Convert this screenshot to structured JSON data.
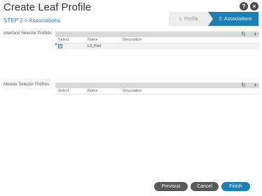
{
  "dialog": {
    "title": "Create Leaf Profile",
    "help_icon": "help-icon",
    "close_icon": "close-icon"
  },
  "step": "STEP 2 > Associations",
  "wizard": {
    "steps": [
      {
        "label": "1. Profile",
        "active": false
      },
      {
        "label": "2. Associations",
        "active": true
      }
    ]
  },
  "interface_selector": {
    "label": "Interface Selector Profiles:",
    "refresh_glyph": "↻",
    "add_glyph": "+",
    "columns": [
      "Select",
      "Name",
      "Description"
    ],
    "rows": [
      {
        "checked": true,
        "check_glyph": "✓",
        "name": "L3_Port",
        "description": ""
      }
    ]
  },
  "module_selector": {
    "label": "Module Selector Profiles:",
    "refresh_glyph": "↻",
    "add_glyph": "+",
    "columns": [
      "Select",
      "Name",
      "Description"
    ],
    "rows": []
  },
  "footer": {
    "previous": "Previous",
    "cancel": "Cancel",
    "finish": "Finish"
  },
  "colors": {
    "accent": "#1e7fb5",
    "button_dark": "#595959",
    "toolbar": "#d9d9d9"
  }
}
